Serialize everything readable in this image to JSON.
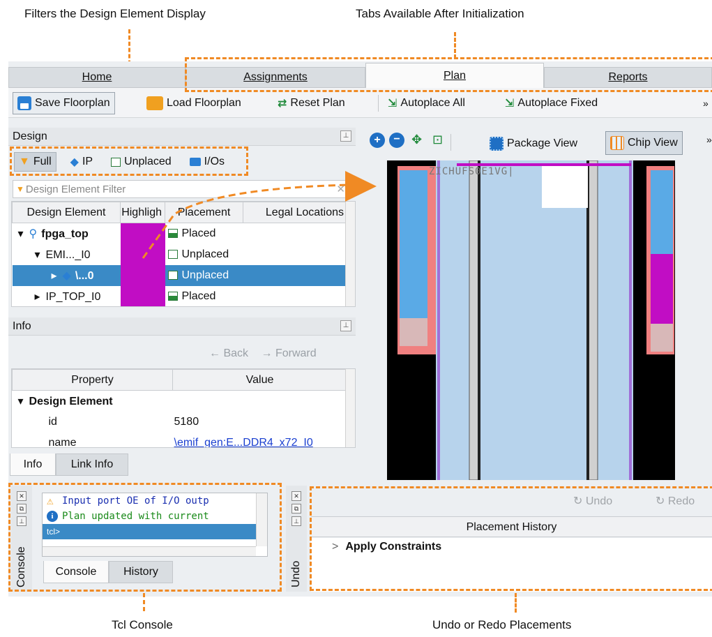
{
  "callouts": {
    "filters": "Filters the Design Element Display",
    "tabs": "Tabs Available After Initialization",
    "tcl": "Tcl Console",
    "undo": "Undo or Redo Placements"
  },
  "tabs": [
    {
      "label": "Home",
      "active": false
    },
    {
      "label": "Assignments",
      "active": false
    },
    {
      "label": "Plan",
      "active": true
    },
    {
      "label": "Reports",
      "active": false
    }
  ],
  "toolbar": {
    "save": "Save Floorplan",
    "load": "Load Floorplan",
    "reset": "Reset Plan",
    "autoplace_all": "Autoplace All",
    "autoplace_fixed": "Autoplace Fixed",
    "overflow": "»"
  },
  "design_panel": {
    "title": "Design",
    "filters": [
      "Full",
      "IP",
      "Unplaced",
      "I/Os"
    ],
    "filter_placeholder": "Design Element Filter",
    "columns": [
      "Design Element",
      "Highligh",
      "Placement",
      "Legal Locations"
    ],
    "rows": [
      {
        "name": "fpga_top",
        "bold": true,
        "expand": "▾",
        "placement": "Placed",
        "status": "placed",
        "selected": false
      },
      {
        "name": "EMI..._I0",
        "bold": false,
        "expand": "▾",
        "placement": "Unplaced",
        "status": "unplaced",
        "selected": false
      },
      {
        "name": "\\...0",
        "bold": true,
        "expand": "▸",
        "placement": "Unplaced",
        "status": "unplaced",
        "selected": true
      },
      {
        "name": "IP_TOP_I0",
        "bold": false,
        "expand": "▸",
        "placement": "Placed",
        "status": "placed",
        "selected": false
      }
    ]
  },
  "view_toolbar": {
    "package_view": "Package View",
    "chip_view": "Chip View",
    "chip_label": "ZICHUFS0E1VG|"
  },
  "info_panel": {
    "title": "Info",
    "back": "Back",
    "forward": "Forward",
    "columns": [
      "Property",
      "Value"
    ],
    "group": "Design Element",
    "properties": [
      {
        "key": "id",
        "value": "5180"
      },
      {
        "key": "name",
        "value": "\\emif_gen:E...DDR4_x72_I0"
      }
    ],
    "tabs": [
      "Info",
      "Link Info"
    ]
  },
  "console": {
    "side_label": "Console",
    "messages": [
      {
        "type": "warning",
        "text": "Input port OE of I/O outp"
      },
      {
        "type": "info",
        "text": "Plan updated with current"
      }
    ],
    "prompt": "tcl>",
    "tabs": [
      "Console",
      "History"
    ]
  },
  "undo_panel": {
    "side_label": "Undo",
    "undo": "Undo",
    "redo": "Redo",
    "header": "Placement History",
    "items": [
      "Apply Constraints"
    ]
  },
  "colors": {
    "accent_orange": "#f08a24",
    "highlight_magenta": "#c10dc4",
    "selection_blue": "#3a8ac6",
    "chip_blue": "#a8c8e8"
  }
}
